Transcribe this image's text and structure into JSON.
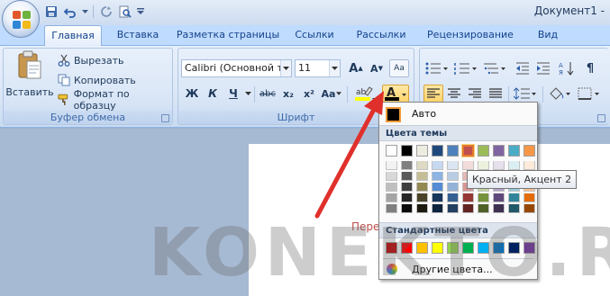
{
  "window": {
    "title": "Документ1 -"
  },
  "tabs": [
    "Главная",
    "Вставка",
    "Разметка страницы",
    "Ссылки",
    "Рассылки",
    "Рецензирование",
    "Вид"
  ],
  "clipboard": {
    "paste_label": "Вставить",
    "cut_label": "Вырезать",
    "copy_label": "Копировать",
    "format_painter_label": "Формат по образцу",
    "group_label": "Буфер обмена"
  },
  "font": {
    "name": "Calibri (Основной те",
    "size": "11",
    "grow_label": "A",
    "shrink_label": "A",
    "clear_label": "Aa",
    "bold_label": "Ж",
    "italic_label": "К",
    "underline_label": "Ч",
    "strike_label": "abc",
    "subscript_label": "x₂",
    "superscript_label": "x²",
    "case_label": "Aa",
    "font_color_label": "A",
    "group_label": "Шрифт"
  },
  "colors": {
    "accent_border": "#8db2e3",
    "font_color_bar": "#000000",
    "highlight_bar": "#ffff00",
    "selected_swatch": "#c0504d"
  },
  "document": {
    "text": "Пере"
  },
  "color_menu": {
    "auto_label": "Авто",
    "theme_header": "Цвета темы",
    "standard_header": "Стандартные цвета",
    "more_label": "Другие цвета...",
    "theme_base": [
      "#ffffff",
      "#000000",
      "#eeece1",
      "#1f497d",
      "#4f81bd",
      "#c0504d",
      "#9bbb59",
      "#8064a2",
      "#4bacc6",
      "#f79646"
    ],
    "theme_shades": [
      [
        "#f2f2f2",
        "#7f7f7f",
        "#ddd9c3",
        "#c6d9f0",
        "#dbe5f1",
        "#f2dcdb",
        "#ebf1dd",
        "#e5e0ec",
        "#dbeef3",
        "#fdeada"
      ],
      [
        "#d8d8d8",
        "#595959",
        "#c4bd97",
        "#8db3e2",
        "#b8cce4",
        "#e5b9b7",
        "#d7e3bc",
        "#ccc1d9",
        "#b7dde8",
        "#fbd5b5"
      ],
      [
        "#bfbfbf",
        "#3f3f3f",
        "#938953",
        "#548dd4",
        "#95b3d7",
        "#d99694",
        "#c3d69b",
        "#b2a2c7",
        "#92cddc",
        "#fac08f"
      ],
      [
        "#a5a5a5",
        "#262626",
        "#494429",
        "#17365d",
        "#366092",
        "#953734",
        "#76923c",
        "#5f497a",
        "#31859b",
        "#e36c09"
      ],
      [
        "#7f7f7f",
        "#0c0c0c",
        "#1d1b10",
        "#0f243e",
        "#244061",
        "#632423",
        "#4f6128",
        "#3f3151",
        "#205867",
        "#974806"
      ]
    ],
    "standard": [
      "#c00000",
      "#ff0000",
      "#ffc000",
      "#ffff00",
      "#92d050",
      "#00b050",
      "#00b0f0",
      "#0070c0",
      "#002060",
      "#7030a0"
    ],
    "selected_index": 5
  },
  "tooltip": {
    "text": "Красный, Акцент 2"
  },
  "watermark": {
    "text": "KONEKTO.RU"
  }
}
